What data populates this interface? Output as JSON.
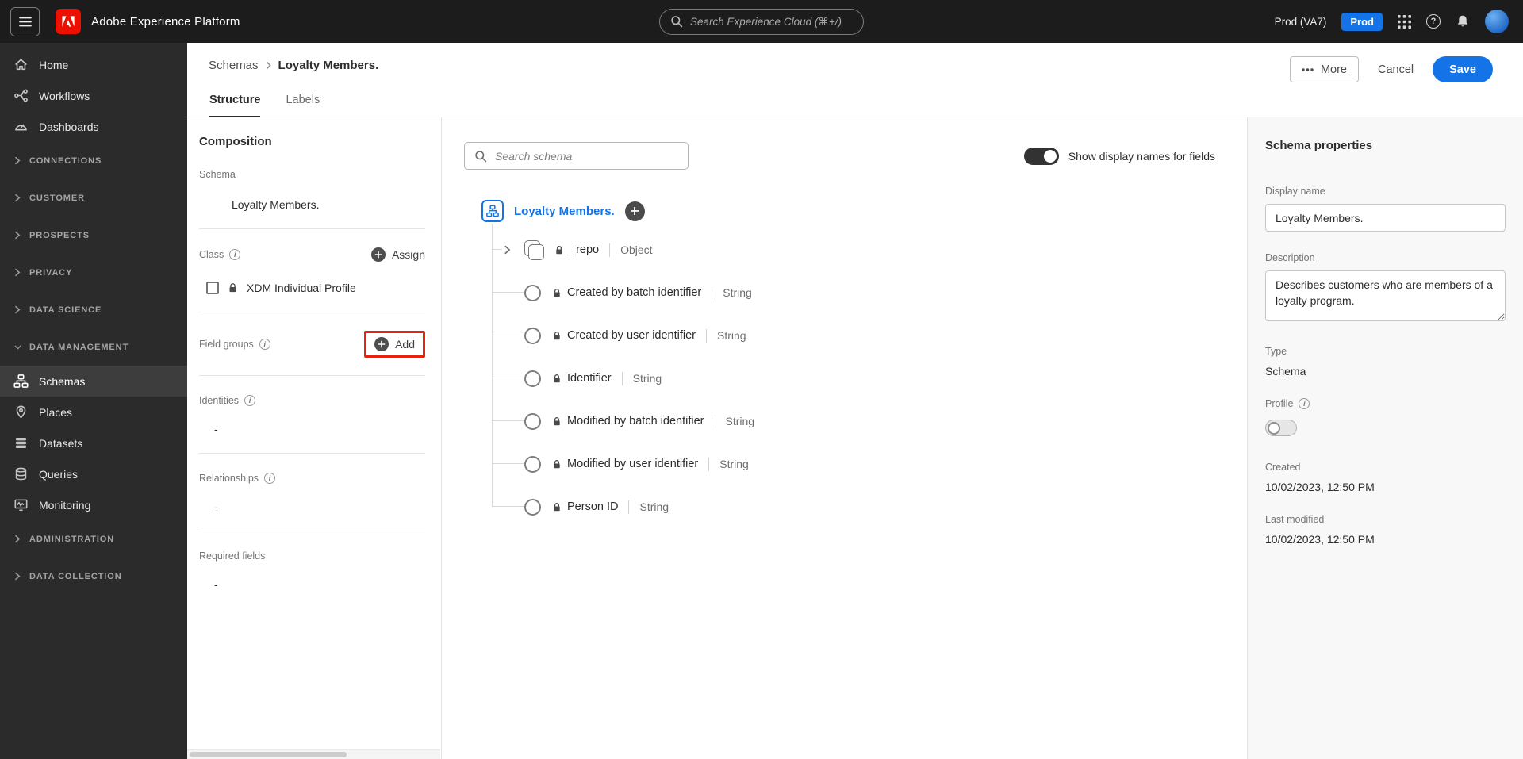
{
  "colors": {
    "accent_blue": "#1473e6",
    "annotation_red": "#e8220f",
    "topbar_bg": "#1c1c1c",
    "sidebar_bg": "#2b2b2b"
  },
  "icons": {
    "info_glyph": "i",
    "help_glyph": "?"
  },
  "topbar": {
    "app_title": "Adobe Experience Platform",
    "search_placeholder": "Search Experience Cloud (⌘+/)",
    "environment": "Prod (VA7)",
    "environment_badge": "Prod"
  },
  "sidebar": {
    "top_items": [
      {
        "label": "Home"
      },
      {
        "label": "Workflows"
      },
      {
        "label": "Dashboards"
      }
    ],
    "sections_top": [
      "CONNECTIONS",
      "CUSTOMER",
      "PROSPECTS",
      "PRIVACY",
      "DATA SCIENCE"
    ],
    "expanded_section": "DATA MANAGEMENT",
    "expanded_items": [
      {
        "label": "Schemas",
        "selected": true
      },
      {
        "label": "Places"
      },
      {
        "label": "Datasets"
      },
      {
        "label": "Queries"
      },
      {
        "label": "Monitoring"
      }
    ],
    "sections_bottom": [
      "ADMINISTRATION",
      "DATA COLLECTION"
    ]
  },
  "header": {
    "breadcrumb_root": "Schemas",
    "breadcrumb_current": "Loyalty Members.",
    "more_label": "More",
    "cancel_label": "Cancel",
    "save_label": "Save",
    "tabs": [
      {
        "label": "Structure",
        "active": true
      },
      {
        "label": "Labels",
        "active": false
      }
    ]
  },
  "composition": {
    "title": "Composition",
    "schema_label": "Schema",
    "schema_name": "Loyalty Members.",
    "class_label": "Class",
    "assign_label": "Assign",
    "class_name": "XDM Individual Profile",
    "field_groups_label": "Field groups",
    "add_label": "Add",
    "identities_label": "Identities",
    "identities_value": "-",
    "relationships_label": "Relationships",
    "relationships_value": "-",
    "required_fields_label": "Required fields",
    "required_fields_value": "-"
  },
  "canvas": {
    "search_placeholder": "Search schema",
    "toggle_label": "Show display names for fields",
    "toggle_on": true,
    "root_name": "Loyalty Members.",
    "fields": [
      {
        "name": "_repo",
        "type": "Object",
        "kind": "object"
      },
      {
        "name": "Created by batch identifier",
        "type": "String",
        "kind": "field"
      },
      {
        "name": "Created by user identifier",
        "type": "String",
        "kind": "field"
      },
      {
        "name": "Identifier",
        "type": "String",
        "kind": "field"
      },
      {
        "name": "Modified by batch identifier",
        "type": "String",
        "kind": "field"
      },
      {
        "name": "Modified by user identifier",
        "type": "String",
        "kind": "field"
      },
      {
        "name": "Person ID",
        "type": "String",
        "kind": "field"
      }
    ]
  },
  "properties": {
    "title": "Schema properties",
    "display_name_label": "Display name",
    "display_name_value": "Loyalty Members.",
    "description_label": "Description",
    "description_value": "Describes customers who are members of a loyalty program.",
    "type_label": "Type",
    "type_value": "Schema",
    "profile_label": "Profile",
    "profile_on": false,
    "created_label": "Created",
    "created_value": "10/02/2023, 12:50 PM",
    "last_modified_label": "Last modified",
    "last_modified_value": "10/02/2023, 12:50 PM"
  }
}
